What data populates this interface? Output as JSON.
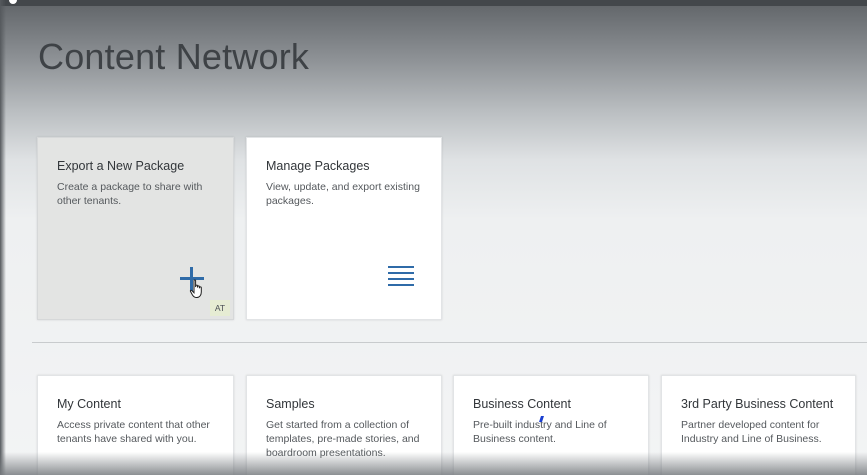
{
  "page": {
    "title": "Content Network"
  },
  "tiles_top": [
    {
      "title": "Export a New Package",
      "subtitle": "Create a package to share with other tenants.",
      "icon": "add-icon",
      "badge": "AT"
    },
    {
      "title": "Manage Packages",
      "subtitle": "View, update, and export existing packages.",
      "icon": "list-icon"
    }
  ],
  "tiles_bottom": [
    {
      "title": "My Content",
      "subtitle": "Access private content that other tenants have shared with you."
    },
    {
      "title": "Samples",
      "subtitle": "Get started from a collection of templates, pre-made stories, and boardroom presentations."
    },
    {
      "title": "Business Content",
      "subtitle": "Pre-built industry and Line of Business content."
    },
    {
      "title": "3rd Party Business Content",
      "subtitle": "Partner developed content for Industry and Line of Business."
    }
  ],
  "colors": {
    "accent": "#2f6ba8",
    "title_text": "#3e4246",
    "tile_background": "#ffffff",
    "tile_hover_background": "#e3e4e3",
    "badge_background": "#e6ecd3"
  }
}
